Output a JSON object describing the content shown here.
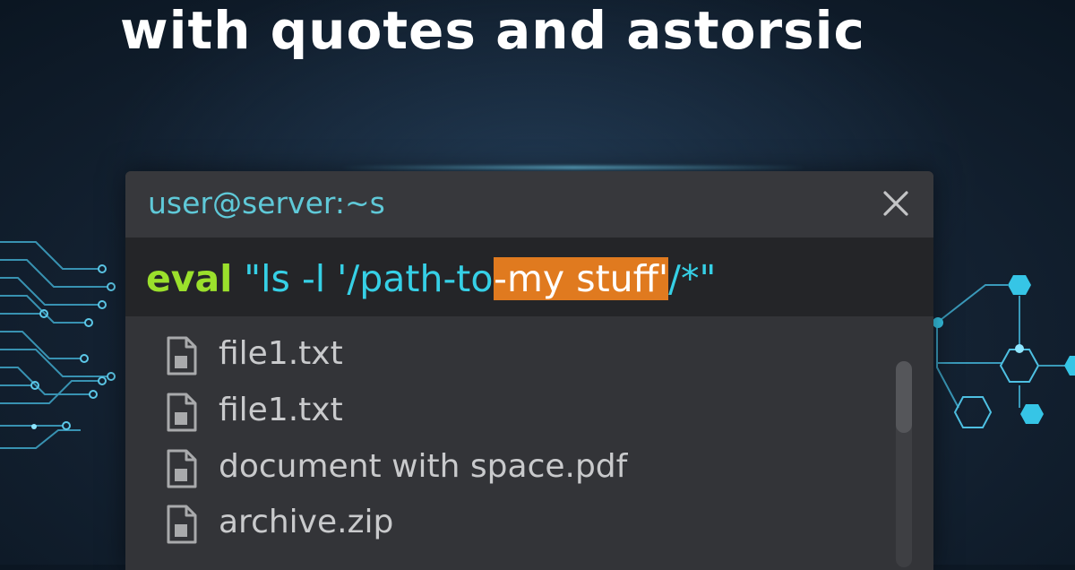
{
  "headline": "with quotes and astorsic",
  "terminal": {
    "title": "user@server:~s",
    "command": {
      "keyword": "eval",
      "before": " \"ls -l '/path-to",
      "highlighted": "-my stuff'",
      "after": "/*\""
    },
    "files": [
      {
        "name": "file1.txt",
        "icon": "file-icon"
      },
      {
        "name": "file1.txt",
        "icon": "file-icon"
      },
      {
        "name": "document with space.pdf",
        "icon": "file-icon"
      },
      {
        "name": "archive.zip",
        "icon": "file-icon"
      }
    ]
  },
  "colors": {
    "accent": "#36d0e6",
    "keyword": "#9be02c",
    "highlight": "#e07a1f",
    "terminal_bg": "#333438"
  }
}
